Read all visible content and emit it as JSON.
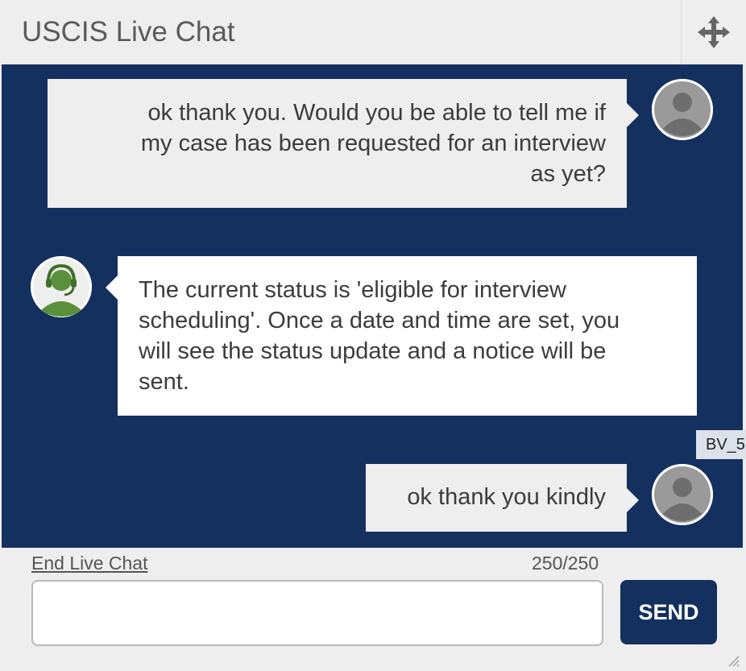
{
  "header": {
    "title": "USCIS Live Chat",
    "move_icon": "move-arrows-icon"
  },
  "messages": [
    {
      "sender": "user",
      "avatar_icon": "user-silhouette-icon",
      "lines": [
        "ok thank you. Would you be able to tell me if",
        "my case has been requested for an interview",
        "as yet?"
      ]
    },
    {
      "sender": "agent",
      "avatar_icon": "agent-headset-icon",
      "lines": [
        "The current status is 'eligible for interview",
        "scheduling'. Once a date and time are set, you",
        "will see the status update and a notice will be",
        "sent."
      ]
    },
    {
      "sender": "user",
      "avatar_icon": "user-silhouette-icon",
      "lines": [
        "ok thank you kindly"
      ]
    }
  ],
  "tooltip": {
    "text": "BV_5"
  },
  "footer": {
    "end_chat_label": "End Live Chat",
    "char_counter": "250/250",
    "input_value": "",
    "input_placeholder": "",
    "send_label": "SEND"
  },
  "colors": {
    "chat_background": "#14305f",
    "user_bubble": "#eeeeee",
    "agent_bubble": "#ffffff",
    "agent_avatar_green": "#5a8f3c",
    "send_button": "#14305f"
  }
}
